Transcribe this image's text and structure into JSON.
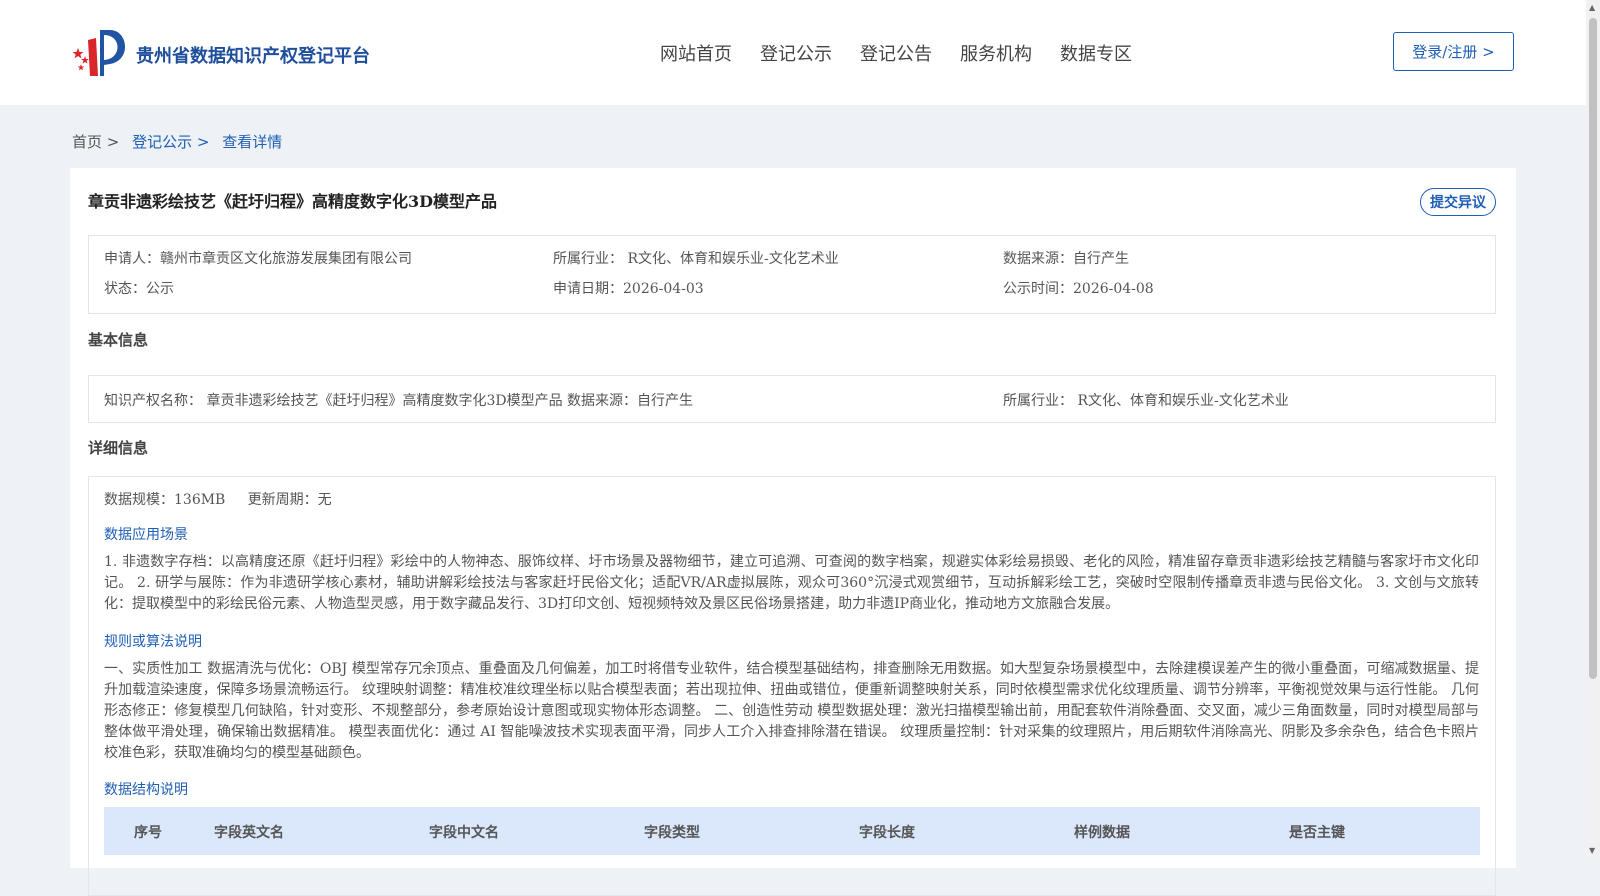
{
  "header": {
    "site_name": "贵州省数据知识产权登记平台",
    "nav": [
      "网站首页",
      "登记公示",
      "登记公告",
      "服务机构",
      "数据专区"
    ],
    "login_label": "登录/注册 >"
  },
  "breadcrumb": {
    "home": "首页 >",
    "list": "登记公示 >",
    "current": "查看详情"
  },
  "detail": {
    "title": "章贡非遗彩绘技艺《赶圩归程》高精度数字化3D模型产品",
    "objection_label": "提交异议",
    "summary": {
      "applicant": "申请人：赣州市章贡区文化旅游发展集团有限公司",
      "industry": "所属行业： R文化、体育和娱乐业-文化艺术业",
      "source": "数据来源：自行产生",
      "status": "状态：公示",
      "apply_date": "申请日期：2026-04-03",
      "publish_date": "公示时间：2026-04-08"
    },
    "basic_heading": "基本信息",
    "basic": {
      "name_and_source": "知识产权名称： 章贡非遗彩绘技艺《赶圩归程》高精度数字化3D模型产品 数据来源：自行产生",
      "industry": "所属行业： R文化、体育和娱乐业-文化艺术业"
    },
    "details_heading": "详细信息",
    "scale_line": "数据规模：136MB     更新周期：无",
    "scenario_heading": "数据应用场景",
    "scenario_text": "1. 非遗数字存档：以高精度还原《赶圩归程》彩绘中的人物神态、服饰纹样、圩市场景及器物细节，建立可追溯、可查阅的数字档案，规避实体彩绘易损毁、老化的风险，精准留存章贡非遗彩绘技艺精髓与客家圩市文化印记。 2. 研学与展陈：作为非遗研学核心素材，辅助讲解彩绘技法与客家赶圩民俗文化；适配VR/AR虚拟展陈，观众可360°沉浸式观赏细节，互动拆解彩绘工艺，突破时空限制传播章贡非遗与民俗文化。 3. 文创与文旅转化：提取模型中的彩绘民俗元素、人物造型灵感，用于数字藏品发行、3D打印文创、短视频特效及景区民俗场景搭建，助力非遗IP商业化，推动地方文旅融合发展。",
    "rules_heading": "规则或算法说明",
    "rules_text": "一、实质性加工 数据清洗与优化：OBJ 模型常存冗余顶点、重叠面及几何偏差，加工时将借专业软件，结合模型基础结构，排查删除无用数据。如大型复杂场景模型中，去除建模误差产生的微小重叠面，可缩减数据量、提升加载渲染速度，保障多场景流畅运行。 纹理映射调整：精准校准纹理坐标以贴合模型表面；若出现拉伸、扭曲或错位，便重新调整映射关系，同时依模型需求优化纹理质量、调节分辨率，平衡视觉效果与运行性能。 几何形态修正：修复模型几何缺陷，针对变形、不规整部分，参考原始设计意图或现实物体形态调整。 二、创造性劳动 模型数据处理：激光扫描模型输出前，用配套软件消除叠面、交叉面，减少三角面数量，同时对模型局部与整体做平滑处理，确保输出数据精准。 模型表面优化：通过 AI 智能噪波技术实现表面平滑，同步人工介入排查排除潜在错误。 纹理质量控制：针对采集的纹理照片，用后期软件消除高光、阴影及多余杂色，结合色卡照片校准色彩，获取准确均匀的模型基础颜色。",
    "structure_heading": "数据结构说明",
    "table_headers": [
      "序号",
      "字段英文名",
      "字段中文名",
      "字段类型",
      "字段长度",
      "样例数据",
      "是否主键"
    ]
  }
}
